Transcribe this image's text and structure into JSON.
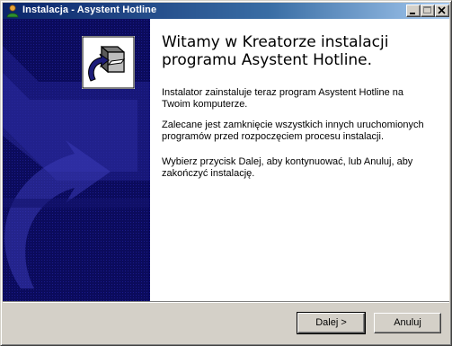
{
  "window": {
    "title": "Instalacja - Asystent Hotline",
    "controls": [
      "minimize-icon",
      "maximize-icon",
      "close-icon"
    ]
  },
  "wizard": {
    "heading": "Witamy w Kreatorze instalacji programu Asystent Hotline.",
    "paragraphs": [
      "Instalator zainstaluje teraz program Asystent Hotline na Twoim komputerze.",
      "Zalecane jest zamknięcie wszystkich innych uruchomionych programów przed rozpoczęciem procesu instalacji.",
      "Wybierz przycisk Dalej, aby kontynuować, lub Anuluj, aby zakończyć instalację."
    ]
  },
  "buttons": {
    "next": "Dalej >",
    "cancel": "Anuluj"
  },
  "colors": {
    "titlebar_start": "#0a246a",
    "titlebar_end": "#a6caf0",
    "side_panel": "#0b0b5c",
    "dialog_face": "#d4d0c8"
  }
}
